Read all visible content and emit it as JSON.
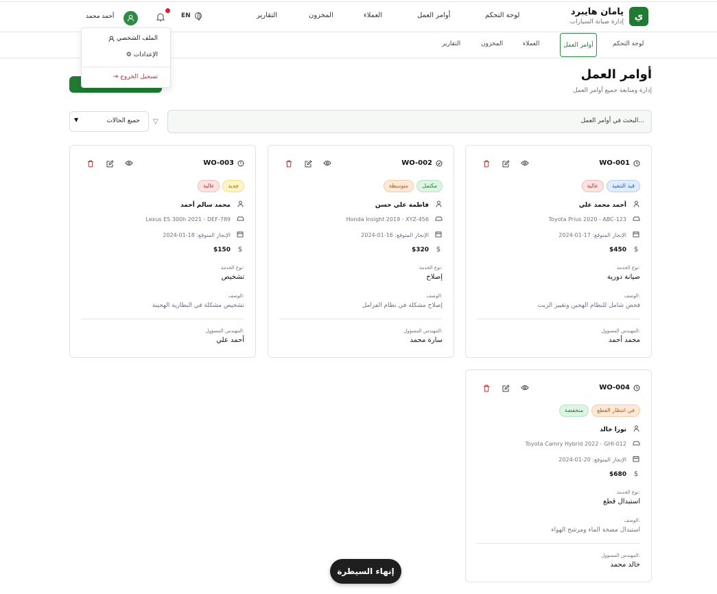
{
  "brand": {
    "logo_letter": "ي",
    "title": "يامان هايبرد",
    "subtitle": "إدارة صيانة السيارات"
  },
  "nav": {
    "dashboard": "لوحة التحكم",
    "work_orders": "أوامر العمل",
    "customers": "العملاء",
    "inventory": "المخزون",
    "reports": "التقارير"
  },
  "header": {
    "language": "EN",
    "user_name": "أحمد محمد"
  },
  "subnav": {
    "dashboard": "لوحة التحكم",
    "work_orders": "أوامر العمل",
    "customers": "العملاء",
    "inventory": "المخزون",
    "reports": "التقارير"
  },
  "dropdown": {
    "profile": "الملف الشخصي",
    "settings": "الإعدادات",
    "logout": "تسجيل الخروج"
  },
  "page": {
    "title": "أوامر العمل",
    "subtitle": "إدارة ومتابعة جميع أوامر العمل"
  },
  "search": {
    "placeholder": "البحث في أوامر العمل..."
  },
  "filter": {
    "status_selected": "جميع الحالات"
  },
  "labels": {
    "service_type": "نوع الخدمة:",
    "description": "الوصف:",
    "engineer": "المهندس المسؤول:",
    "due_prefix": "الإنجاز المتوقع:"
  },
  "orders": [
    {
      "id": "WO-001",
      "status": "قيد التنفيذ",
      "priority": "عالية",
      "customer": "أحمد محمد علي",
      "vehicle": "Toyota Prius 2020 - ABC-123",
      "due": "17-01-2024",
      "cost": "$450",
      "service": "صيانة دورية",
      "description": "فحص شامل للنظام الهجين وتغيير الزيت",
      "engineer": "محمد أحمد"
    },
    {
      "id": "WO-002",
      "status": "مكتمل",
      "priority": "متوسطة",
      "customer": "فاطمة علي حسن",
      "vehicle": "Honda Insight 2019 - XYZ-456",
      "due": "16-01-2024",
      "cost": "$320",
      "service": "إصلاح",
      "description": "إصلاح مشكلة في نظام الفرامل",
      "engineer": "سارة محمد"
    },
    {
      "id": "WO-003",
      "status": "جديد",
      "priority": "عالية",
      "customer": "محمد سالم أحمد",
      "vehicle": "Lexus ES 300h 2021 - DEF-789",
      "due": "18-01-2024",
      "cost": "$150",
      "service": "تشخيص",
      "description": "تشخيص مشكلة في البطارية الهجينة",
      "engineer": "أحمد علي"
    },
    {
      "id": "WO-004",
      "status": "في انتظار القطع",
      "priority": "منخفضة",
      "customer": "نورا خالد",
      "vehicle": "Toyota Camry Hybrid 2022 - GHI-012",
      "due": "20-01-2024",
      "cost": "$680",
      "service": "استبدال قطع",
      "description": "استبدال مضخة الماء ومرشح الهواء",
      "engineer": "خالد محمد"
    }
  ],
  "fab": {
    "label": "إنهاء السيطرة"
  },
  "icons": {
    "status_progress": "clock-icon",
    "status_done": "check-circle-icon",
    "status_new": "alert-circle-icon",
    "delete": "trash-icon",
    "edit": "edit-icon",
    "view": "eye-icon"
  },
  "colors": {
    "brand": "#1f7a32",
    "danger": "#dc2626"
  }
}
